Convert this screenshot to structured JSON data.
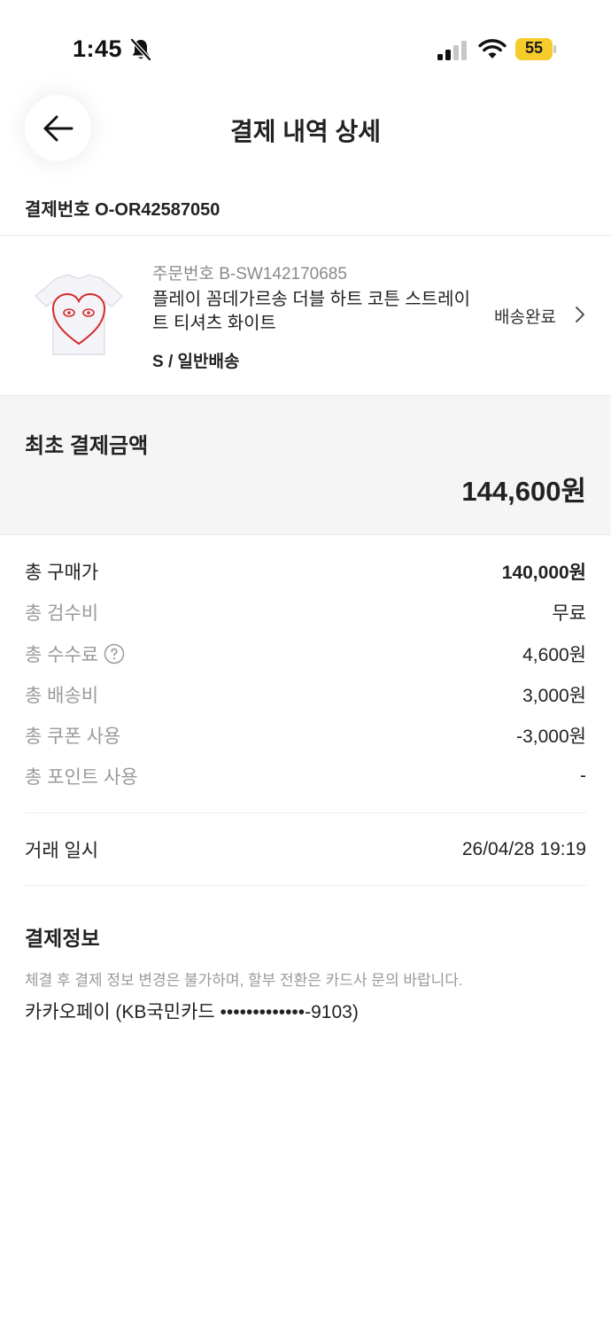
{
  "status_bar": {
    "time": "1:45",
    "battery": "55",
    "icons": [
      "bell-slash-icon",
      "signal-icon",
      "wifi-icon",
      "battery-icon"
    ],
    "battery_color": "#f6cc2d"
  },
  "header": {
    "title": "결제 내역 상세",
    "back_icon": "arrow-left-icon"
  },
  "payment": {
    "label": "결제번호",
    "number": "O-OR42587050"
  },
  "product": {
    "order_label": "주문번호",
    "order_number": "B-SW142170685",
    "name": "플레이 꼼데가르송 더블 하트 코튼 스트레이트 티셔츠 화이트",
    "option": "S / 일반배송",
    "status": "배송완료",
    "thumbnail_icon": "tshirt-heart-icon"
  },
  "initial_payment": {
    "label": "최초 결제금액",
    "amount": "144,600원"
  },
  "breakdown": {
    "rows": [
      {
        "label": "총 구매가",
        "value": "140,000원"
      },
      {
        "label": "총 검수비",
        "value": "무료"
      },
      {
        "label": "총 수수료",
        "value": "4,600원"
      },
      {
        "label": "총 배송비",
        "value": "3,000원"
      },
      {
        "label": "총 쿠폰 사용",
        "value": "-3,000원"
      },
      {
        "label": "총 포인트 사용",
        "value": "-"
      }
    ],
    "transaction": {
      "label": "거래 일시",
      "value": "26/04/28 19:19"
    }
  },
  "payment_info": {
    "title": "결제정보",
    "note": "체결 후 결제 정보 변경은 불가하며, 할부 전환은 카드사 문의 바랍니다.",
    "method": "카카오페이 (KB국민카드 •••••••••••••-9103)"
  },
  "colors": {
    "accent_heart": "#d62b2b",
    "muted_text": "#9a9a9a",
    "section_bg": "#f5f5f5"
  }
}
